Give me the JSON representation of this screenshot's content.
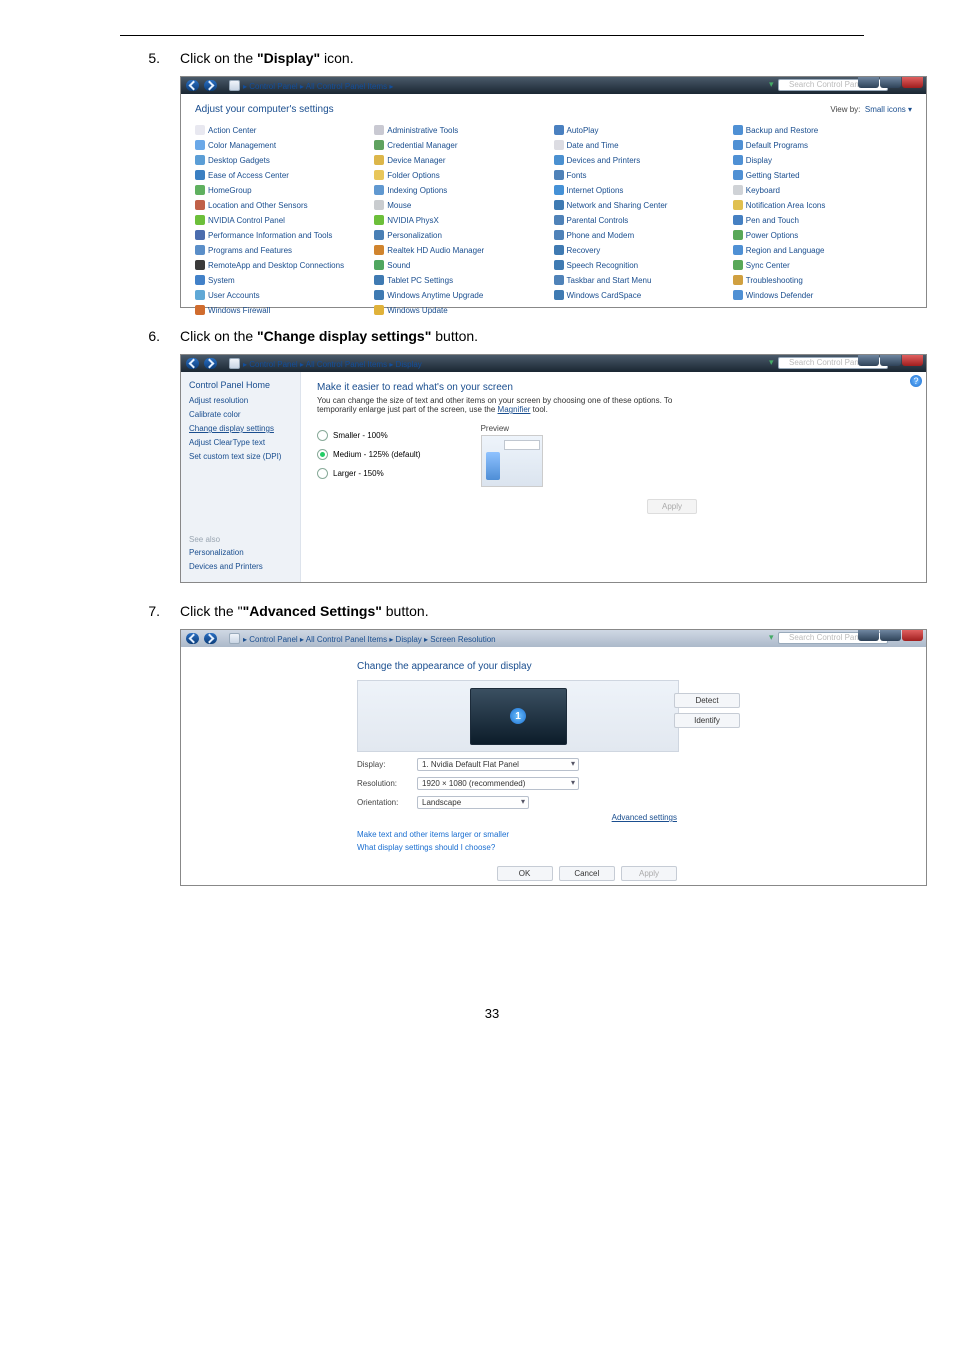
{
  "steps": {
    "s5": {
      "num": "5.",
      "prefix": "Click on the ",
      "bold": "\"Display\"",
      "suffix": " icon."
    },
    "s6": {
      "num": "6.",
      "prefix": "Click on the ",
      "bold": "\"Change display settings\"",
      "suffix": " button."
    },
    "s7": {
      "num": "7.",
      "prefix": "Click the ",
      "bold": "\"Advanced Settings\"",
      "suffix": " button."
    }
  },
  "win1": {
    "crumbs": "▸ Control Panel ▸ All Control Panel Items ▸",
    "search": "Search Control Panel",
    "heading": "Adjust your computer's settings",
    "viewby_label": "View by:",
    "viewby_value": "Small icons ▾",
    "items": {
      "c1": [
        "Action Center",
        "Color Management",
        "Desktop Gadgets",
        "Ease of Access Center",
        "HomeGroup",
        "Location and Other Sensors",
        "NVIDIA Control Panel",
        "Performance Information and Tools",
        "Programs and Features",
        "RemoteApp and Desktop Connections",
        "System",
        "User Accounts",
        "Windows Firewall"
      ],
      "c2": [
        "Administrative Tools",
        "Credential Manager",
        "Device Manager",
        "Folder Options",
        "Indexing Options",
        "Mouse",
        "NVIDIA PhysX",
        "Personalization",
        "Realtek HD Audio Manager",
        "Sound",
        "Tablet PC Settings",
        "Windows Anytime Upgrade",
        "Windows Update"
      ],
      "c3": [
        "AutoPlay",
        "Date and Time",
        "Devices and Printers",
        "Fonts",
        "Internet Options",
        "Network and Sharing Center",
        "Parental Controls",
        "Phone and Modem",
        "Recovery",
        "Speech Recognition",
        "Taskbar and Start Menu",
        "Windows CardSpace"
      ],
      "c4": [
        "Backup and Restore",
        "Default Programs",
        "Display",
        "Getting Started",
        "Keyboard",
        "Notification Area Icons",
        "Pen and Touch",
        "Power Options",
        "Region and Language",
        "Sync Center",
        "Troubleshooting",
        "Windows Defender"
      ]
    },
    "icon_colors": {
      "c1": [
        "#e8e8f0",
        "#6aa8e8",
        "#5b9ed6",
        "#3a7fc2",
        "#5fb05f",
        "#c06048",
        "#6cbf3a",
        "#4a6cae",
        "#5a8ec8",
        "#3a3a3a",
        "#4281c8",
        "#5fa8d6",
        "#d06c2e"
      ],
      "c2": [
        "#c9c9d2",
        "#5fa25f",
        "#dcb64a",
        "#e8c65a",
        "#6098d0",
        "#c9cccf",
        "#6cbf3a",
        "#497fb5",
        "#d0842e",
        "#4fa65f",
        "#3f7ab2",
        "#3f7ab2",
        "#e0b23a"
      ],
      "c3": [
        "#4a80c0",
        "#dcdce2",
        "#4a90d0",
        "#4f82b8",
        "#4591d6",
        "#3f7ab2",
        "#4f82b8",
        "#4f82b8",
        "#3f7ab2",
        "#3f7ab2",
        "#4f82b8",
        "#3f7ab2"
      ],
      "c4": [
        "#4f90d4",
        "#4f90d4",
        "#4f90d4",
        "#4f90d4",
        "#cfd2d6",
        "#e0c050",
        "#4580c2",
        "#58a858",
        "#4f90d4",
        "#58a858",
        "#d0a040",
        "#4f90d4"
      ]
    }
  },
  "win2": {
    "crumbs": "▸ Control Panel ▸ All Control Panel Items ▸ Display",
    "search": "Search Control Panel",
    "left_head": "Control Panel Home",
    "left_links": [
      "Adjust resolution",
      "Calibrate color",
      "Change display settings",
      "Adjust ClearType text",
      "Set custom text size (DPI)"
    ],
    "current_link_index": 2,
    "seealso_label": "See also",
    "seealso_links": [
      "Personalization",
      "Devices and Printers"
    ],
    "title": "Make it easier to read what's on your screen",
    "sub1": "You can change the size of text and other items on your screen by choosing one of these options. To",
    "sub2": "temporarily enlarge just part of the screen, use the ",
    "sub_link": "Magnifier",
    "sub3": " tool.",
    "radios": [
      {
        "label": "Smaller - 100%",
        "on": false
      },
      {
        "label": "Medium - 125% (default)",
        "on": true
      },
      {
        "label": "Larger - 150%",
        "on": false
      }
    ],
    "preview_label": "Preview",
    "apply": "Apply"
  },
  "win3": {
    "crumbs": "▸ Control Panel ▸ All Control Panel Items ▸ Display ▸ Screen Resolution",
    "search": "Search Control Panel",
    "title": "Change the appearance of your display",
    "monitor_num": "1",
    "detect": "Detect",
    "identify": "Identify",
    "rows": {
      "display": {
        "label": "Display:",
        "value": "1. Nvidia Default Flat Panel"
      },
      "resolution": {
        "label": "Resolution:",
        "value": "1920 × 1080 (recommended)"
      },
      "orientation": {
        "label": "Orientation:",
        "value": "Landscape"
      }
    },
    "advanced": "Advanced settings",
    "link1": "Make text and other items larger or smaller",
    "link2": "What display settings should I choose?",
    "ok": "OK",
    "cancel": "Cancel",
    "apply": "Apply"
  },
  "page_number": "33"
}
